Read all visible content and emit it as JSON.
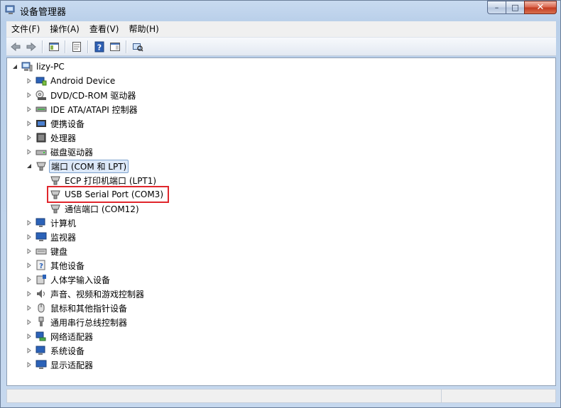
{
  "window": {
    "title": "设备管理器",
    "caption_min": "–",
    "caption_max": "□",
    "caption_close": "✕"
  },
  "menu": [
    {
      "label": "文件(F)"
    },
    {
      "label": "操作(A)"
    },
    {
      "label": "查看(V)"
    },
    {
      "label": "帮助(H)"
    }
  ],
  "toolbar": {
    "buttons": [
      "back-icon",
      "forward-icon",
      "show-hide-tree-icon",
      "properties-icon",
      "help-icon",
      "console-tree-icon",
      "scan-hardware-icon"
    ]
  },
  "tree": {
    "root": {
      "label": "lizy-PC"
    },
    "categories": [
      {
        "label": "Android Device"
      },
      {
        "label": "DVD/CD-ROM 驱动器"
      },
      {
        "label": "IDE ATA/ATAPI 控制器"
      },
      {
        "label": "便携设备"
      },
      {
        "label": "处理器"
      },
      {
        "label": "磁盘驱动器"
      },
      {
        "label": "端口 (COM 和 LPT)"
      },
      {
        "label": "计算机"
      },
      {
        "label": "监视器"
      },
      {
        "label": "键盘"
      },
      {
        "label": "其他设备"
      },
      {
        "label": "人体学输入设备"
      },
      {
        "label": "声音、视频和游戏控制器"
      },
      {
        "label": "鼠标和其他指针设备"
      },
      {
        "label": "通用串行总线控制器"
      },
      {
        "label": "网络适配器"
      },
      {
        "label": "系统设备"
      },
      {
        "label": "显示适配器"
      }
    ],
    "ports_children": [
      {
        "label": "ECP 打印机端口 (LPT1)"
      },
      {
        "label": "USB Serial Port (COM3)"
      },
      {
        "label": "通信端口 (COM12)"
      }
    ]
  },
  "colors": {
    "highlight_border": "#e0262c",
    "selection_bg": "#dde9f9"
  }
}
